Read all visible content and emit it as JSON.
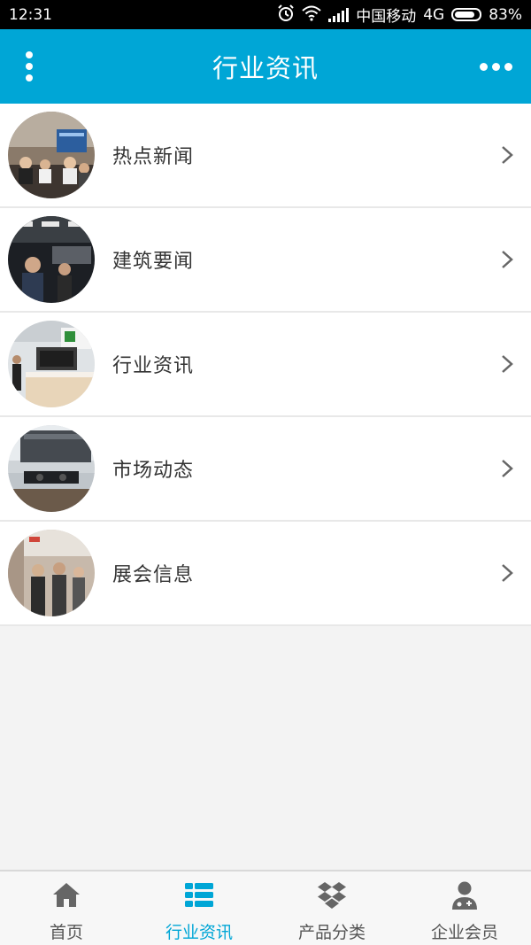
{
  "status_bar": {
    "time": "12:31",
    "carrier": "中国移动",
    "network": "4G",
    "battery": "83%",
    "battery_level": 0.83
  },
  "app_bar": {
    "title": "行业资讯",
    "left_icon": "vertical-dots-menu-icon",
    "right_icon": "horizontal-dots-more-icon"
  },
  "list": {
    "items": [
      {
        "label": "热点新闻",
        "thumb": "meeting-photo"
      },
      {
        "label": "建筑要闻",
        "thumb": "indoor-people-photo"
      },
      {
        "label": "行业资讯",
        "thumb": "showroom-photo"
      },
      {
        "label": "市场动态",
        "thumb": "kitchen-appliance-photo"
      },
      {
        "label": "展会信息",
        "thumb": "exhibition-photo"
      }
    ]
  },
  "bottom_nav": {
    "items": [
      {
        "label": "首页",
        "icon": "home-icon",
        "active": false
      },
      {
        "label": "行业资讯",
        "icon": "list-icon",
        "active": true
      },
      {
        "label": "产品分类",
        "icon": "dropbox-box-icon",
        "active": false
      },
      {
        "label": "企业会员",
        "icon": "doctor-user-icon",
        "active": false
      }
    ],
    "active_color": "#00a6d6",
    "inactive_color": "#555555"
  },
  "colors": {
    "accent": "#00a6d6",
    "background": "#f3f3f3"
  }
}
